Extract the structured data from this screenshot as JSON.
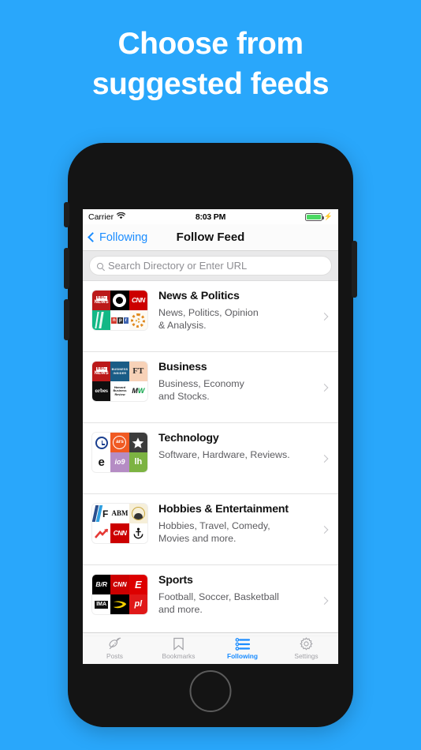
{
  "headline": {
    "line1": "Choose from",
    "line2": "suggested feeds"
  },
  "colors": {
    "background": "#29a7fb",
    "accent": "#1a8cff",
    "phone_body": "#141414",
    "battery_green": "#4cd964"
  },
  "phone": {
    "status_bar": {
      "carrier": "Carrier",
      "wifi_icon": "wifi-icon",
      "time": "8:03 PM",
      "battery_icon": "battery-icon",
      "charging_icon": "charging-bolt-icon"
    },
    "nav_bar": {
      "back_label": "Following",
      "back_icon": "chevron-left-icon",
      "title": "Follow Feed"
    },
    "search": {
      "icon": "search-icon",
      "placeholder": "Search Directory or Enter URL",
      "value": ""
    },
    "feeds": [
      {
        "title": "News & Politics",
        "desc_line1": "News, Politics, Opinion",
        "desc_line2": "& Analysis.",
        "tiles": [
          {
            "label": "BBC NEWS",
            "kind": "bbc"
          },
          {
            "label": "CBC",
            "kind": "cbc"
          },
          {
            "label": "CNN",
            "kind": "cnn"
          },
          {
            "label": "",
            "kind": "green"
          },
          {
            "label": "npr",
            "kind": "npr"
          },
          {
            "label": "",
            "kind": "sunburst"
          }
        ]
      },
      {
        "title": "Business",
        "desc_line1": "Business, Economy",
        "desc_line2": "and Stocks.",
        "tiles": [
          {
            "label": "BBC NEWS",
            "kind": "bbc"
          },
          {
            "label": "BUSINESS INSIDER",
            "kind": "bi"
          },
          {
            "label": "FT",
            "kind": "ft"
          },
          {
            "label": "Forbes",
            "kind": "forbes"
          },
          {
            "label": "Harvard Business Review",
            "kind": "hbr"
          },
          {
            "label": "MW",
            "kind": "mw"
          }
        ]
      },
      {
        "title": "Technology",
        "desc_line1": "Software, Hardware, Reviews.",
        "desc_line2": "",
        "tiles": [
          {
            "label": "",
            "kind": "clock"
          },
          {
            "label": "ars",
            "kind": "ars"
          },
          {
            "label": "",
            "kind": "star"
          },
          {
            "label": "e",
            "kind": "engadget"
          },
          {
            "label": "io9",
            "kind": "io9"
          },
          {
            "label": "lh",
            "kind": "lifehacker"
          }
        ]
      },
      {
        "title": "Hobbies & Entertainment",
        "desc_line1": "Hobbies, Travel, Comedy,",
        "desc_line2": "Movies and more.",
        "tiles": [
          {
            "label": "F",
            "kind": "flipboard"
          },
          {
            "label": "ABM",
            "kind": "abm"
          },
          {
            "label": "",
            "kind": "coin"
          },
          {
            "label": "",
            "kind": "arrow"
          },
          {
            "label": "CNN",
            "kind": "cnn"
          },
          {
            "label": "",
            "kind": "anchor"
          }
        ]
      },
      {
        "title": "Sports",
        "desc_line1": "Football, Soccer, Basketball",
        "desc_line2": "and more.",
        "tiles": [
          {
            "label": "B/R",
            "kind": "br"
          },
          {
            "label": "CNN",
            "kind": "cnn2"
          },
          {
            "label": "E",
            "kind": "espn"
          },
          {
            "label": "IMA",
            "kind": "ima"
          },
          {
            "label": "",
            "kind": "swoosh"
          },
          {
            "label": "pl",
            "kind": "pl"
          }
        ]
      }
    ],
    "tab_bar": [
      {
        "label": "Posts",
        "icon": "satellite-dish-icon",
        "active": false
      },
      {
        "label": "Bookmarks",
        "icon": "bookmark-icon",
        "active": false
      },
      {
        "label": "Following",
        "icon": "list-icon",
        "active": true
      },
      {
        "label": "Settings",
        "icon": "gear-icon",
        "active": false
      }
    ],
    "home_button": "home-button"
  }
}
